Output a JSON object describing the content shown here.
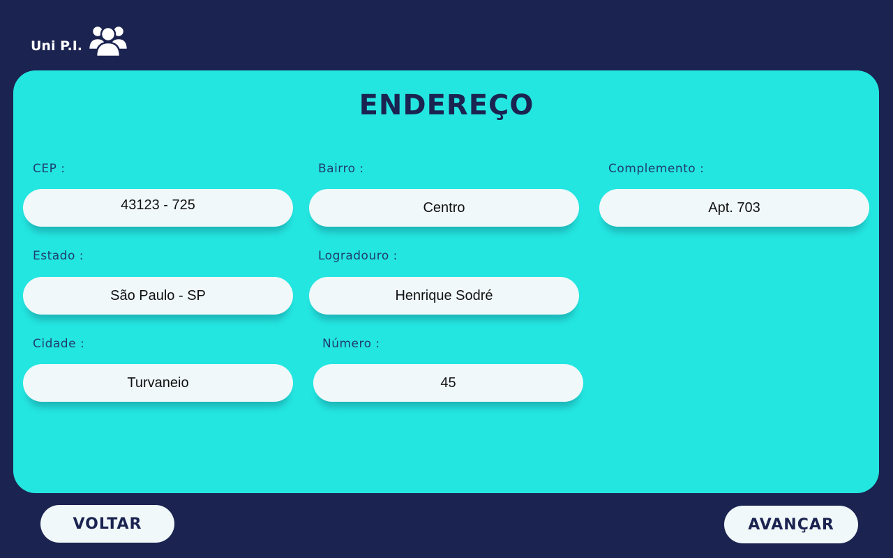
{
  "brand": {
    "name": "Uni P.I.",
    "icon": "users-group-icon"
  },
  "form": {
    "title": "ENDEREÇO",
    "fields": {
      "cep": {
        "label": "CEP  :",
        "value": "43123 - 725"
      },
      "bairro": {
        "label": "Bairro  :",
        "value": "Centro"
      },
      "complemento": {
        "label": "Complemento  :",
        "value": "Apt. 703"
      },
      "estado": {
        "label": "Estado  :",
        "value": "São Paulo - SP"
      },
      "logradouro": {
        "label": "Logradouro   :",
        "value": "Henrique Sodré"
      },
      "cidade": {
        "label": "Cidade  :",
        "value": "Turvaneio"
      },
      "numero": {
        "label": "Número   :",
        "value": "45"
      }
    }
  },
  "actions": {
    "back_label": "VOLTAR",
    "next_label": "AVANÇAR"
  },
  "colors": {
    "background": "#1b2350",
    "card": "#24e6e1",
    "field": "#f1f8fa",
    "title": "#1b2350"
  }
}
